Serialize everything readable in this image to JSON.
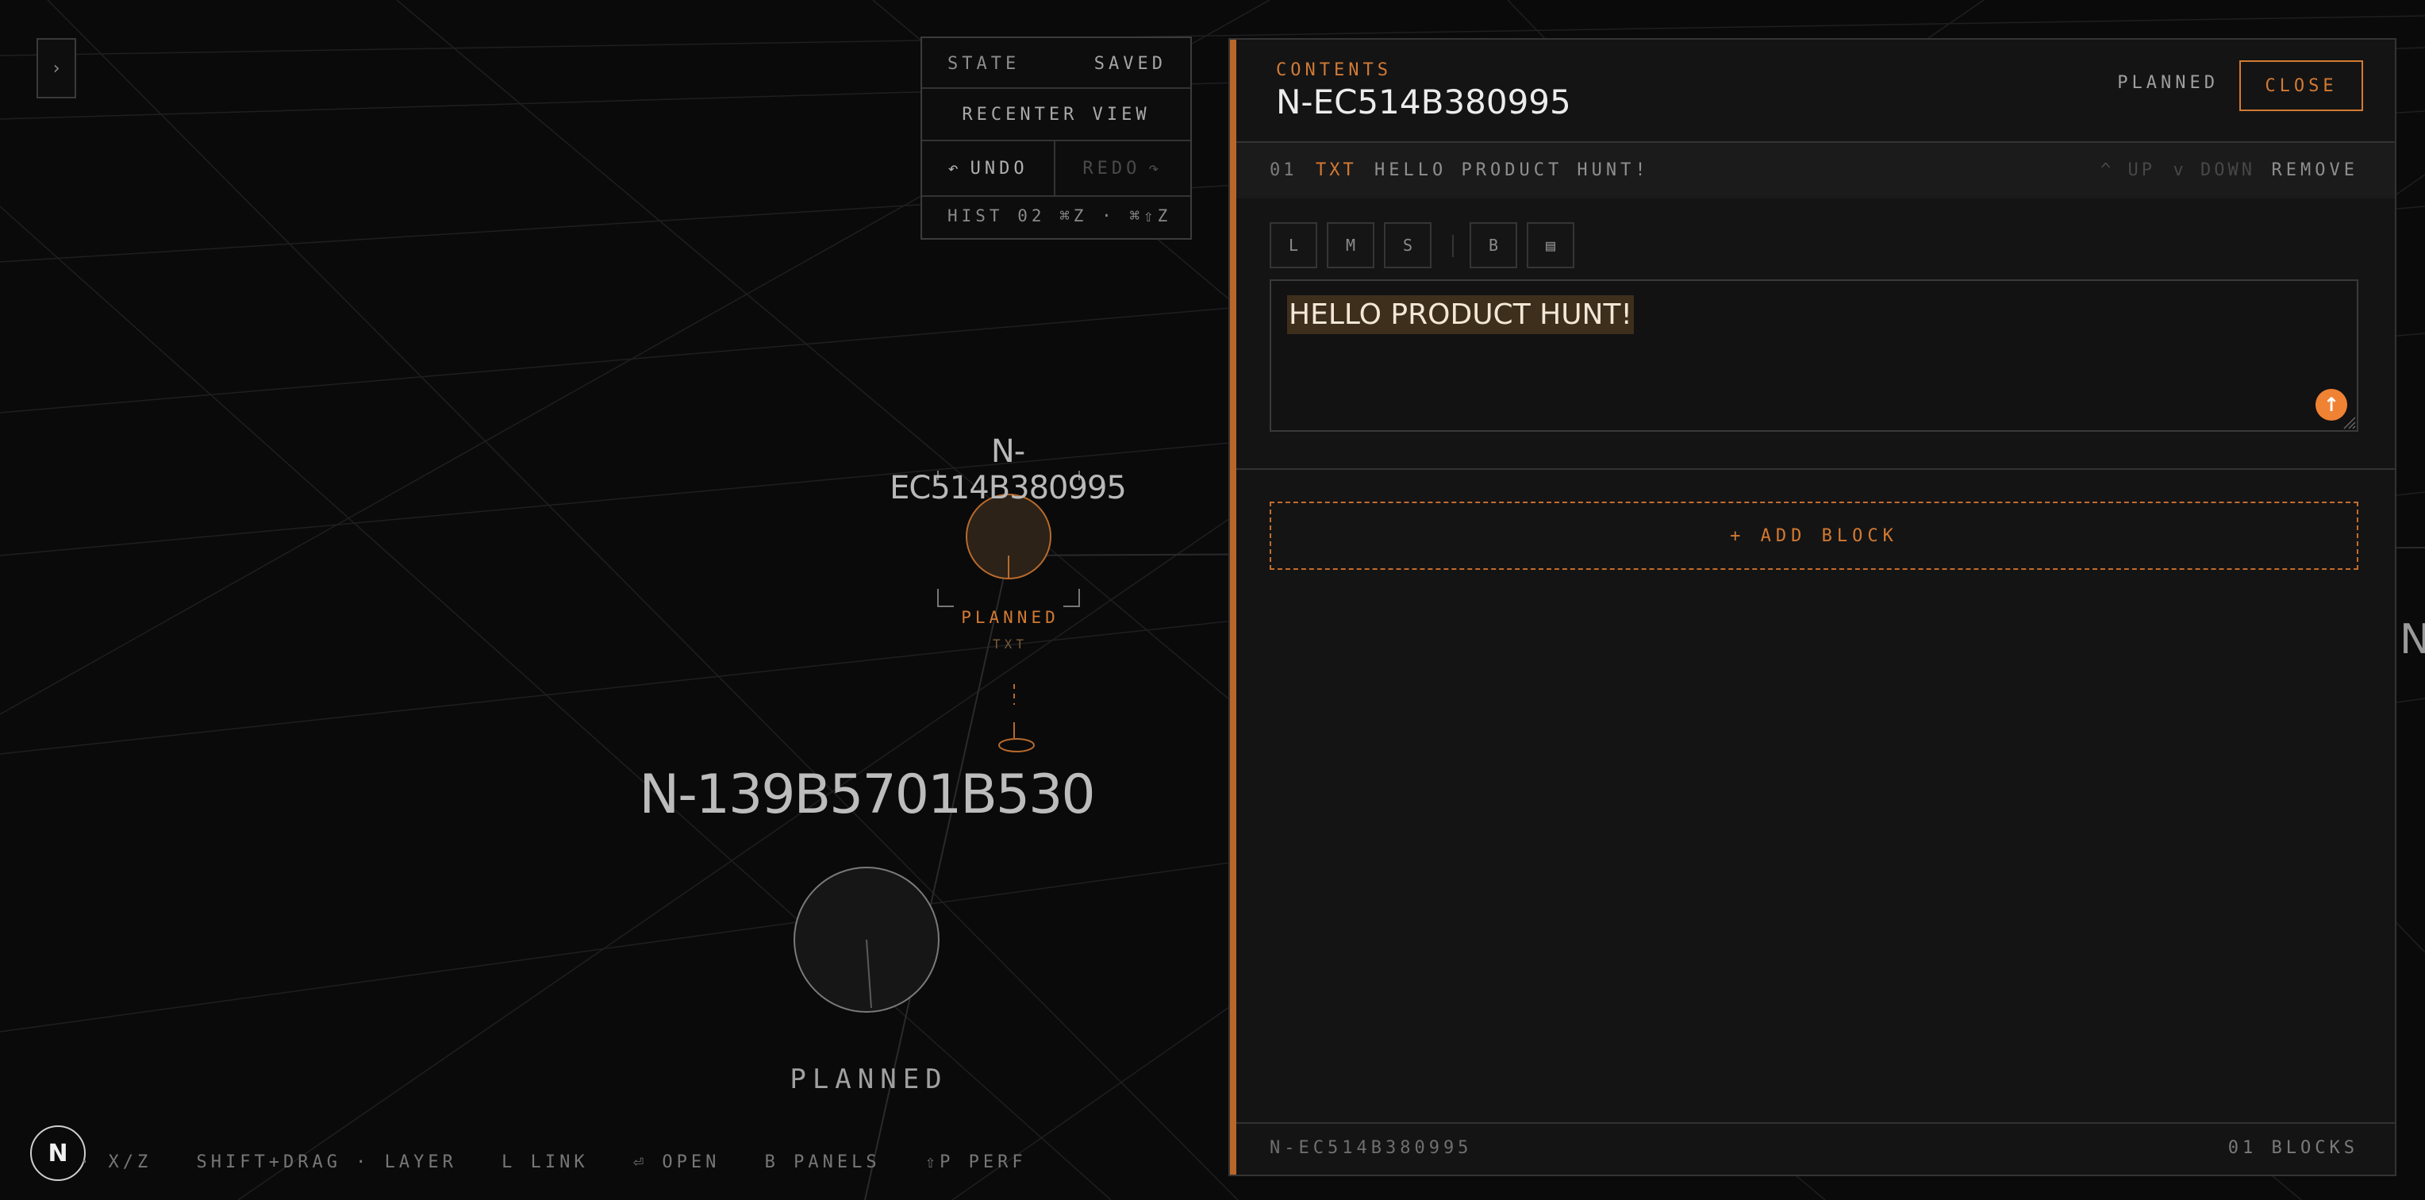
{
  "colors": {
    "accent": "#d47a32",
    "background": "#0a0a0b",
    "panel": "#141415"
  },
  "sidebar_toggle": {
    "glyph": "›",
    "icon": "chevron-right-icon"
  },
  "history": {
    "state_label": "STATE",
    "state_value": "SAVED",
    "recenter_label": "RECENTER VIEW",
    "undo_label": "UNDO",
    "redo_label": "REDO",
    "hist_text": "HIST 02 ⌘Z · ⌘⇧Z"
  },
  "scene": {
    "node_small": {
      "label": "N-EC514B380995",
      "status": "PLANNED",
      "type": "TXT"
    },
    "node_large": {
      "label": "N-139B5701B530",
      "status": "PLANNED"
    },
    "edge_text": "N"
  },
  "bottom_bar": {
    "logo": "N",
    "hints": [
      "· X/Z",
      "SHIFT+DRAG · LAYER",
      "L LINK",
      "⏎ OPEN",
      "B PANELS",
      "⇧P PERF"
    ]
  },
  "panel": {
    "kicker": "CONTENTS",
    "title": "N-EC514B380995",
    "status": "PLANNED",
    "close_label": "CLOSE",
    "block": {
      "index": "01",
      "type": "TXT",
      "text": "HELLO PRODUCT HUNT!",
      "up_label": "UP",
      "down_label": "DOWN",
      "remove_label": "REMOVE"
    },
    "format_buttons": [
      "L",
      "M",
      "S",
      "B",
      "▤"
    ],
    "editor_text": "HELLO PRODUCT HUNT!",
    "add_block_label": "+ ADD BLOCK",
    "footer_id": "N-EC514B380995",
    "footer_count": "01 BLOCKS"
  }
}
